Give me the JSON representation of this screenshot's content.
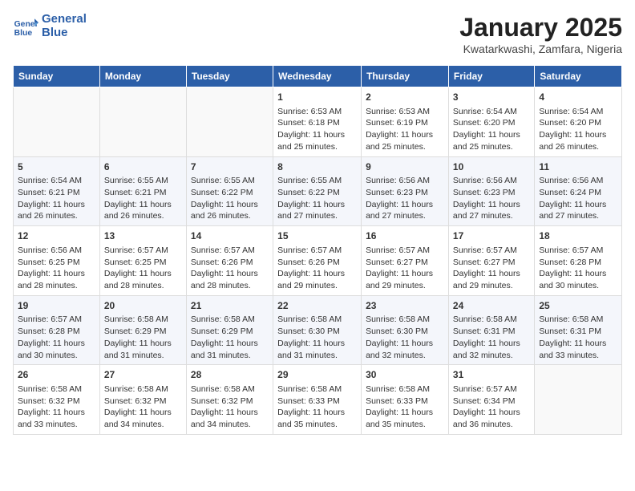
{
  "header": {
    "logo_line1": "General",
    "logo_line2": "Blue",
    "month_title": "January 2025",
    "subtitle": "Kwatarkwashi, Zamfara, Nigeria"
  },
  "days_of_week": [
    "Sunday",
    "Monday",
    "Tuesday",
    "Wednesday",
    "Thursday",
    "Friday",
    "Saturday"
  ],
  "weeks": [
    [
      {
        "day": "",
        "info": ""
      },
      {
        "day": "",
        "info": ""
      },
      {
        "day": "",
        "info": ""
      },
      {
        "day": "1",
        "info": "Sunrise: 6:53 AM\nSunset: 6:18 PM\nDaylight: 11 hours and 25 minutes."
      },
      {
        "day": "2",
        "info": "Sunrise: 6:53 AM\nSunset: 6:19 PM\nDaylight: 11 hours and 25 minutes."
      },
      {
        "day": "3",
        "info": "Sunrise: 6:54 AM\nSunset: 6:20 PM\nDaylight: 11 hours and 25 minutes."
      },
      {
        "day": "4",
        "info": "Sunrise: 6:54 AM\nSunset: 6:20 PM\nDaylight: 11 hours and 26 minutes."
      }
    ],
    [
      {
        "day": "5",
        "info": "Sunrise: 6:54 AM\nSunset: 6:21 PM\nDaylight: 11 hours and 26 minutes."
      },
      {
        "day": "6",
        "info": "Sunrise: 6:55 AM\nSunset: 6:21 PM\nDaylight: 11 hours and 26 minutes."
      },
      {
        "day": "7",
        "info": "Sunrise: 6:55 AM\nSunset: 6:22 PM\nDaylight: 11 hours and 26 minutes."
      },
      {
        "day": "8",
        "info": "Sunrise: 6:55 AM\nSunset: 6:22 PM\nDaylight: 11 hours and 27 minutes."
      },
      {
        "day": "9",
        "info": "Sunrise: 6:56 AM\nSunset: 6:23 PM\nDaylight: 11 hours and 27 minutes."
      },
      {
        "day": "10",
        "info": "Sunrise: 6:56 AM\nSunset: 6:23 PM\nDaylight: 11 hours and 27 minutes."
      },
      {
        "day": "11",
        "info": "Sunrise: 6:56 AM\nSunset: 6:24 PM\nDaylight: 11 hours and 27 minutes."
      }
    ],
    [
      {
        "day": "12",
        "info": "Sunrise: 6:56 AM\nSunset: 6:25 PM\nDaylight: 11 hours and 28 minutes."
      },
      {
        "day": "13",
        "info": "Sunrise: 6:57 AM\nSunset: 6:25 PM\nDaylight: 11 hours and 28 minutes."
      },
      {
        "day": "14",
        "info": "Sunrise: 6:57 AM\nSunset: 6:26 PM\nDaylight: 11 hours and 28 minutes."
      },
      {
        "day": "15",
        "info": "Sunrise: 6:57 AM\nSunset: 6:26 PM\nDaylight: 11 hours and 29 minutes."
      },
      {
        "day": "16",
        "info": "Sunrise: 6:57 AM\nSunset: 6:27 PM\nDaylight: 11 hours and 29 minutes."
      },
      {
        "day": "17",
        "info": "Sunrise: 6:57 AM\nSunset: 6:27 PM\nDaylight: 11 hours and 29 minutes."
      },
      {
        "day": "18",
        "info": "Sunrise: 6:57 AM\nSunset: 6:28 PM\nDaylight: 11 hours and 30 minutes."
      }
    ],
    [
      {
        "day": "19",
        "info": "Sunrise: 6:57 AM\nSunset: 6:28 PM\nDaylight: 11 hours and 30 minutes."
      },
      {
        "day": "20",
        "info": "Sunrise: 6:58 AM\nSunset: 6:29 PM\nDaylight: 11 hours and 31 minutes."
      },
      {
        "day": "21",
        "info": "Sunrise: 6:58 AM\nSunset: 6:29 PM\nDaylight: 11 hours and 31 minutes."
      },
      {
        "day": "22",
        "info": "Sunrise: 6:58 AM\nSunset: 6:30 PM\nDaylight: 11 hours and 31 minutes."
      },
      {
        "day": "23",
        "info": "Sunrise: 6:58 AM\nSunset: 6:30 PM\nDaylight: 11 hours and 32 minutes."
      },
      {
        "day": "24",
        "info": "Sunrise: 6:58 AM\nSunset: 6:31 PM\nDaylight: 11 hours and 32 minutes."
      },
      {
        "day": "25",
        "info": "Sunrise: 6:58 AM\nSunset: 6:31 PM\nDaylight: 11 hours and 33 minutes."
      }
    ],
    [
      {
        "day": "26",
        "info": "Sunrise: 6:58 AM\nSunset: 6:32 PM\nDaylight: 11 hours and 33 minutes."
      },
      {
        "day": "27",
        "info": "Sunrise: 6:58 AM\nSunset: 6:32 PM\nDaylight: 11 hours and 34 minutes."
      },
      {
        "day": "28",
        "info": "Sunrise: 6:58 AM\nSunset: 6:32 PM\nDaylight: 11 hours and 34 minutes."
      },
      {
        "day": "29",
        "info": "Sunrise: 6:58 AM\nSunset: 6:33 PM\nDaylight: 11 hours and 35 minutes."
      },
      {
        "day": "30",
        "info": "Sunrise: 6:58 AM\nSunset: 6:33 PM\nDaylight: 11 hours and 35 minutes."
      },
      {
        "day": "31",
        "info": "Sunrise: 6:57 AM\nSunset: 6:34 PM\nDaylight: 11 hours and 36 minutes."
      },
      {
        "day": "",
        "info": ""
      }
    ]
  ]
}
